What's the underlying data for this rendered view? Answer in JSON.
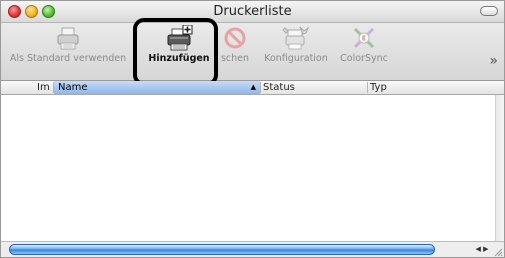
{
  "window": {
    "title": "Druckerliste"
  },
  "toolbar": {
    "items": [
      {
        "label": "Als Standard verwenden",
        "icon": "default-printer-icon",
        "active": false
      },
      {
        "label": "Hinzufügen",
        "icon": "add-printer-icon",
        "active": true
      },
      {
        "label": "Löschen",
        "icon": "delete-icon",
        "active": false,
        "visible_label": "schen"
      },
      {
        "label": "Konfiguration",
        "icon": "configure-icon",
        "active": false
      },
      {
        "label": "ColorSync",
        "icon": "colorsync-icon",
        "active": false
      }
    ],
    "overflow": "»"
  },
  "table": {
    "columns": [
      "Im",
      "Name",
      "Status",
      "Typ"
    ],
    "sorted_column": "Name",
    "sort_indicator": "▲",
    "rows": []
  },
  "scrollbar": {
    "arrows": "◀ ▶"
  }
}
